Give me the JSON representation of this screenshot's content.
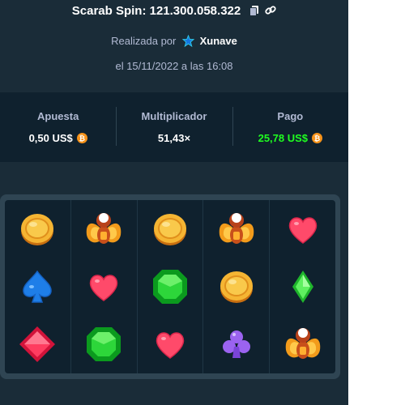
{
  "header": {
    "title": "Scarab Spin: 121.300.058.322",
    "made_by_prefix": "Realizada por",
    "username": "Xunave",
    "date_line": "el 15/11/2022 a las 16:08"
  },
  "stats": {
    "bet_label": "Apuesta",
    "bet_value": "0,50 US$",
    "multiplier_label": "Multiplicador",
    "multiplier_value": "51,43×",
    "payout_label": "Pago",
    "payout_value": "25,78 US$",
    "currency_icon": "bitcoin-icon"
  },
  "colors": {
    "panel_bg": "#1a2c38",
    "stats_bg": "#0f212e",
    "payout_green": "#1fff20",
    "coin_orange": "#f7931a"
  },
  "reels": [
    [
      "coin",
      "spade",
      "diamond-red"
    ],
    [
      "scarab",
      "heart",
      "emerald"
    ],
    [
      "coin",
      "emerald",
      "heart"
    ],
    [
      "scarab",
      "coin",
      "club"
    ],
    [
      "heart",
      "diamond-green",
      "scarab"
    ]
  ]
}
